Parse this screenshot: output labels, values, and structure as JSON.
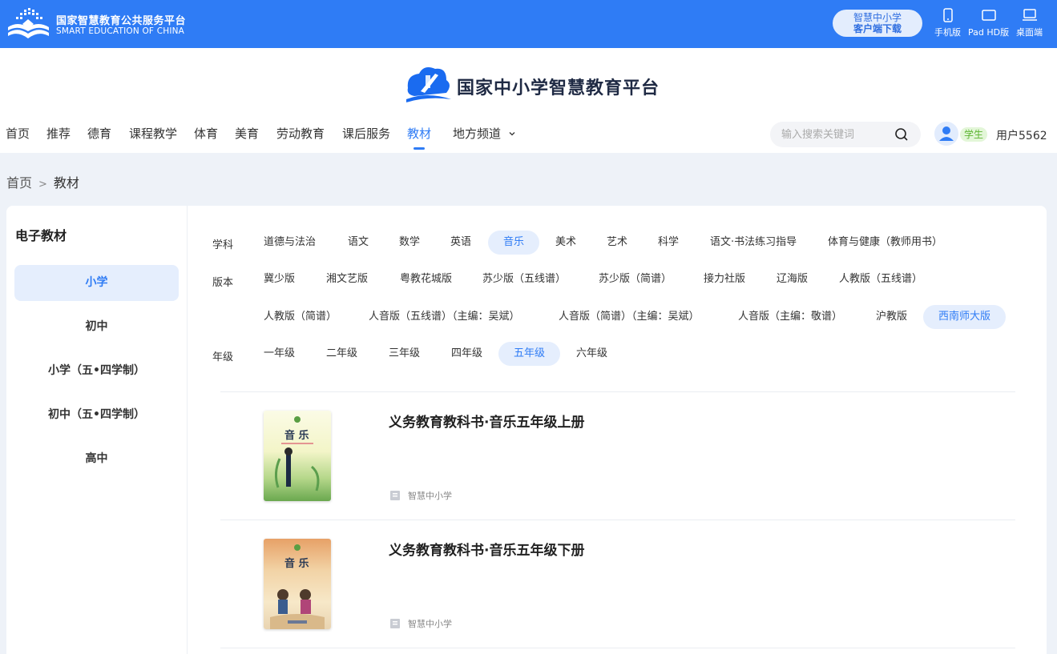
{
  "topbar": {
    "title": "国家智慧教育公共服务平台",
    "subtitle": "SMART EDUCATION OF CHINA",
    "download_line1": "智慧中小学",
    "download_line2": "客户端下载",
    "devices": [
      "手机版",
      "Pad HD版",
      "桌面端"
    ]
  },
  "header": {
    "site_title": "国家中小学智慧教育平台",
    "nav": [
      "首页",
      "推荐",
      "德育",
      "课程教学",
      "体育",
      "美育",
      "劳动教育",
      "课后服务",
      "教材",
      "地方频道"
    ],
    "active_nav": "教材",
    "search_placeholder": "输入搜索关键词",
    "role_badge": "学生",
    "username": "用户5562"
  },
  "breadcrumb": {
    "home": "首页",
    "sep": ">",
    "current": "教材"
  },
  "sidebar": {
    "title": "电子教材",
    "items": [
      "小学",
      "初中",
      "小学（五•四学制）",
      "初中（五•四学制）",
      "高中"
    ],
    "active": "小学"
  },
  "filters": {
    "subject_label": "学科",
    "subjects": [
      "道德与法治",
      "语文",
      "数学",
      "英语",
      "音乐",
      "美术",
      "艺术",
      "科学",
      "语文·书法练习指导",
      "体育与健康（教师用书）"
    ],
    "active_subject": "音乐",
    "edition_label": "版本",
    "editions": [
      "冀少版",
      "湘文艺版",
      "粤教花城版",
      "苏少版（五线谱）",
      "苏少版（简谱）",
      "接力社版",
      "辽海版",
      "人教版（五线谱）",
      "人教版（简谱）",
      "人音版（五线谱）（主编：吴斌）",
      "人音版（简谱）（主编：吴斌）",
      "人音版（主编：敬谱）",
      "沪教版",
      "西南师大版"
    ],
    "active_edition": "西南师大版",
    "grade_label": "年级",
    "grades": [
      "一年级",
      "二年级",
      "三年级",
      "四年级",
      "五年级",
      "六年级"
    ],
    "active_grade": "五年级"
  },
  "books": [
    {
      "title": "义务教育教科书·音乐五年级上册",
      "source": "智慧中小学",
      "cover_text": "音 乐"
    },
    {
      "title": "义务教育教科书·音乐五年级下册",
      "source": "智慧中小学",
      "cover_text": "音 乐"
    }
  ],
  "colors": {
    "primary": "#2f7cf5",
    "active_bg": "#e5eefd",
    "badge_green": "#5cb531"
  }
}
